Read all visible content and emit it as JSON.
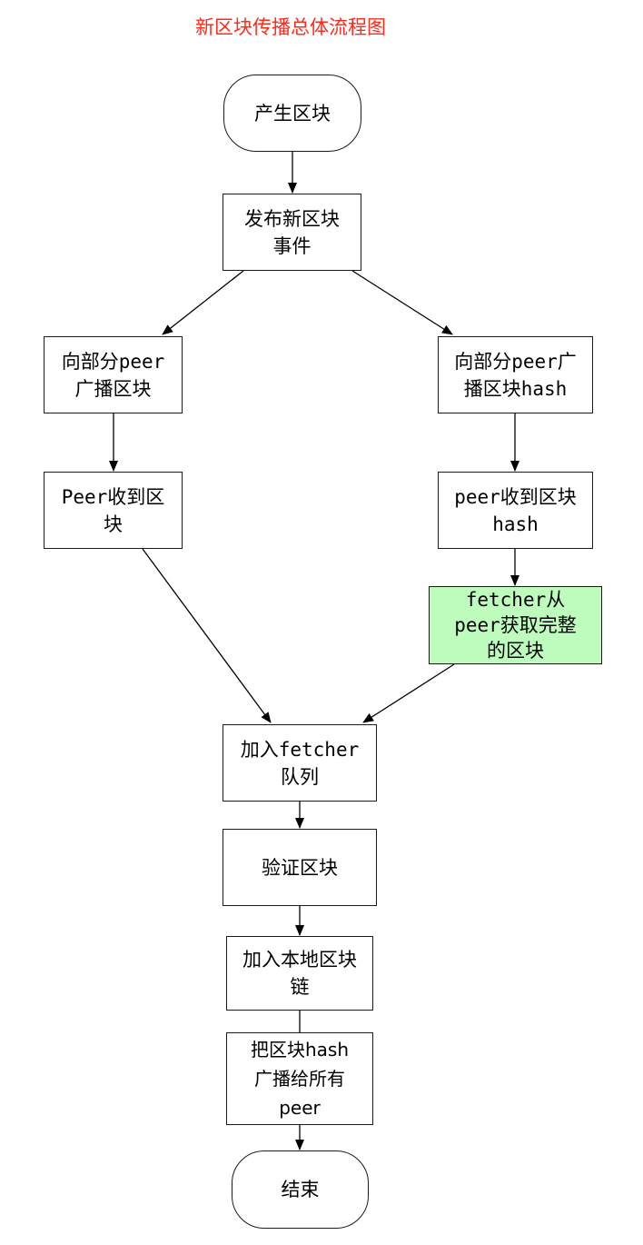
{
  "title": "新区块传播总体流程图",
  "nodes": {
    "start": "产生区块",
    "publish_event": "发布新区块\n事件",
    "broadcast_block": "向部分peer\n广播区块",
    "broadcast_hash": "向部分peer广\n播区块hash",
    "recv_block": "Peer收到区\n块",
    "recv_hash": "peer收到区块\nhash",
    "fetch_full": "fetcher从\npeer获取完整\n的区块",
    "enqueue": "加入fetcher\n队列",
    "verify": "验证区块",
    "add_chain": "加入本地区块\n链",
    "broadcast_all": "把区块hash\n广播给所有\npeer",
    "end": "结束"
  },
  "colors": {
    "title": "#ff2a1a",
    "highlight": "#bdfcbc",
    "stroke": "#1a1a1a"
  }
}
